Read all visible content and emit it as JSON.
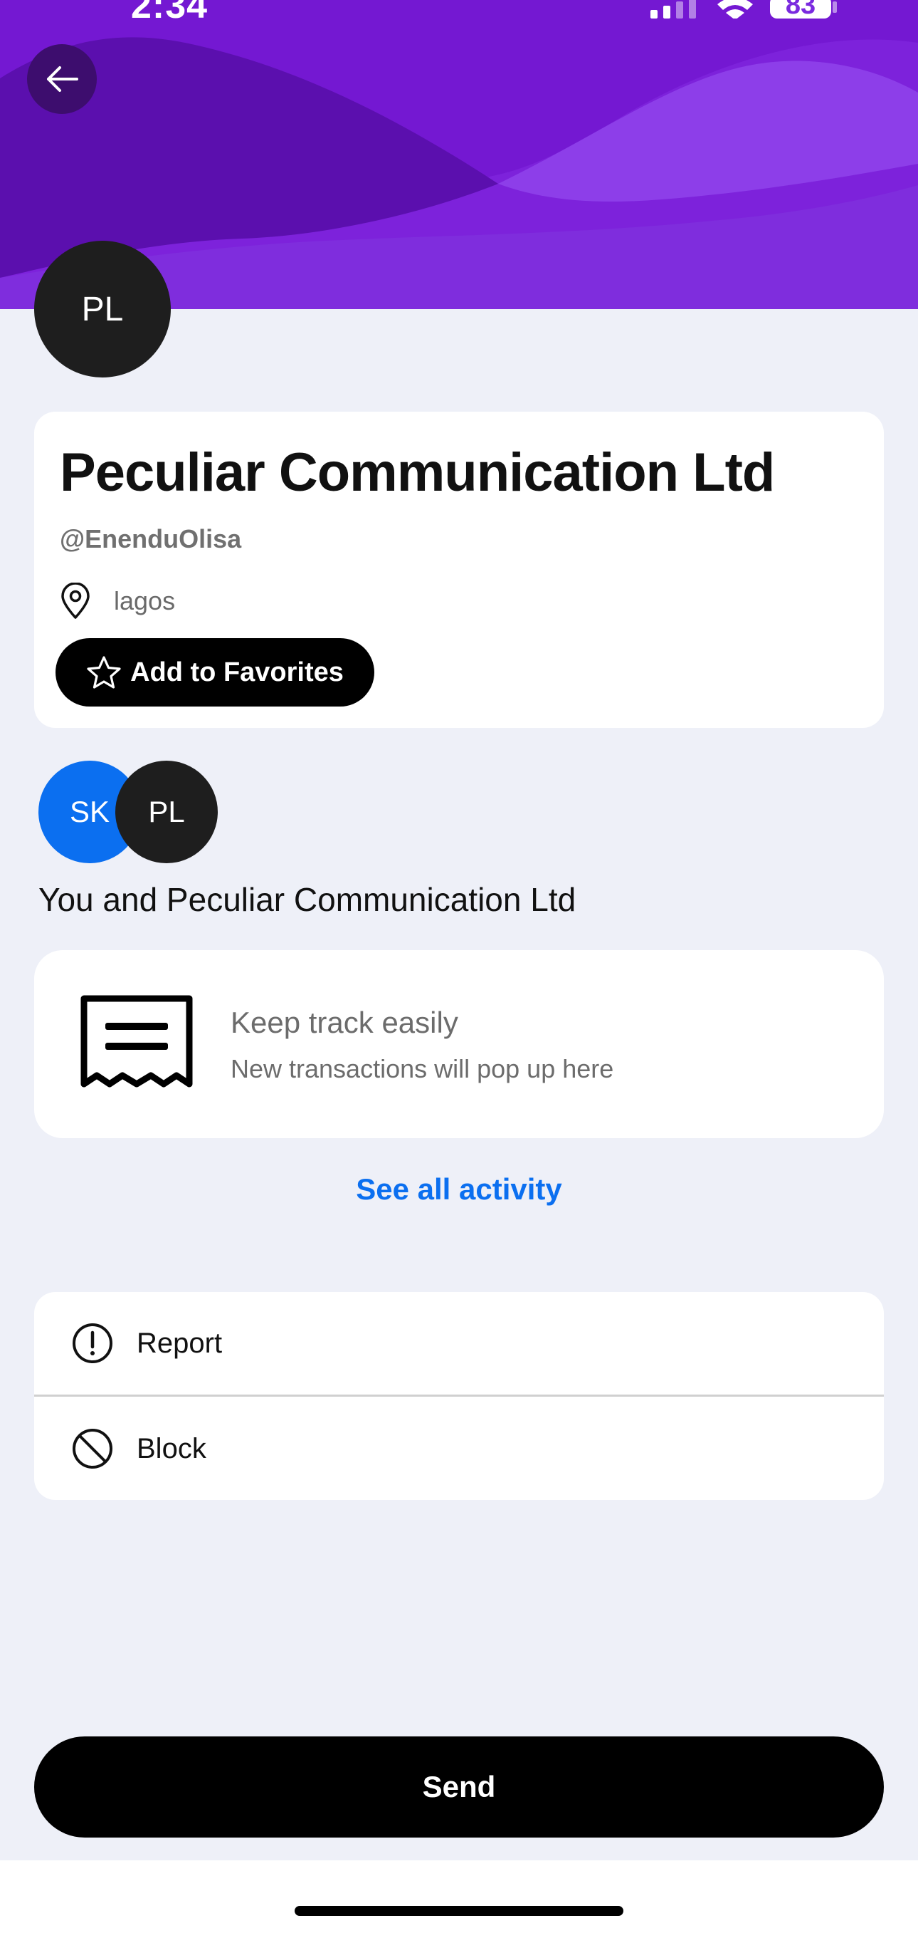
{
  "status_bar": {
    "time": "2:34",
    "battery": "83"
  },
  "header": {
    "back_icon": "arrow-left-icon",
    "banner_colors": [
      "#7b1fd8",
      "#5a0eb0",
      "#8a3ee8"
    ]
  },
  "profile": {
    "initials": "PL",
    "name": "Peculiar Communication Ltd",
    "handle": "@EnenduOlisa",
    "location": "lagos",
    "favorite_label": "Add to Favorites"
  },
  "shared": {
    "avatars": [
      {
        "initials": "SK",
        "color": "#0b6ff0"
      },
      {
        "initials": "PL",
        "color": "#1e1e1e"
      }
    ],
    "label": "You and Peculiar Communication Ltd"
  },
  "activity": {
    "empty_title": "Keep track easily",
    "empty_subtitle": "New transactions will pop up here",
    "see_all": "See all activity"
  },
  "actions": [
    {
      "label": "Report",
      "icon": "exclamation-circle-icon"
    },
    {
      "label": "Block",
      "icon": "block-icon"
    }
  ],
  "send_label": "Send",
  "colors": {
    "accent_blue": "#0b6ff0",
    "background": "#eef0f8",
    "brand_purple": "#7b1fd8"
  }
}
